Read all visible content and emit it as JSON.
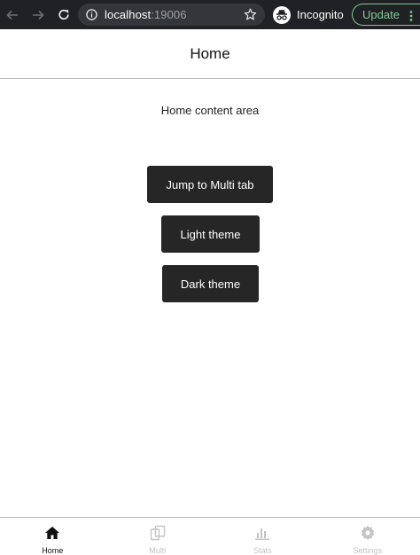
{
  "browser": {
    "url_host": "localhost",
    "url_port": ":19006",
    "incognito_label": "Incognito",
    "update_label": "Update"
  },
  "header": {
    "title": "Home"
  },
  "main": {
    "content_label": "Home content area",
    "buttons": {
      "jump": "Jump to Multi tab",
      "light": "Light theme",
      "dark": "Dark theme"
    }
  },
  "tabbar": {
    "tabs": [
      {
        "label": "Home",
        "icon": "home-icon",
        "active": true
      },
      {
        "label": "Multi",
        "icon": "multi-copy-icon",
        "active": false
      },
      {
        "label": "Stats",
        "icon": "bar-chart-icon",
        "active": false
      },
      {
        "label": "Settings",
        "icon": "gear-icon",
        "active": false
      }
    ]
  },
  "colors": {
    "chrome_bg": "#202124",
    "omnibox_bg": "#35363a",
    "update_green": "#81c995",
    "button_bg": "#262626",
    "tab_inactive": "#c4c4c4",
    "tab_active": "#111111"
  }
}
